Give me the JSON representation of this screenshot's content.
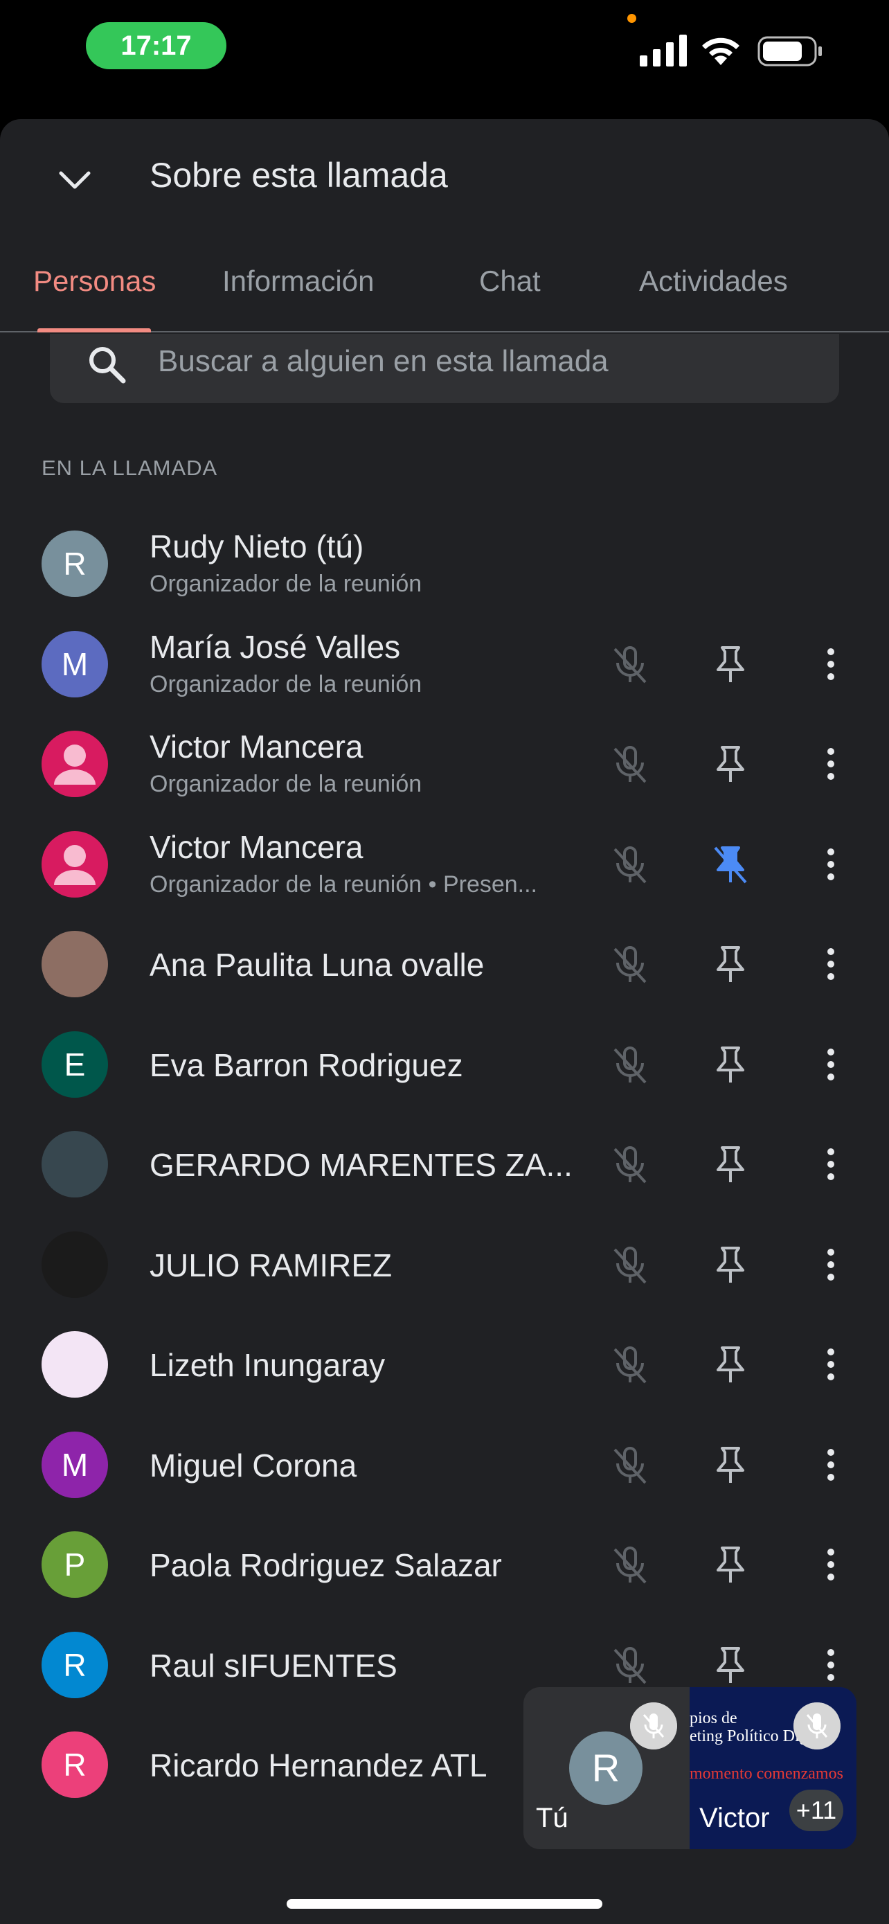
{
  "status_bar": {
    "time": "17:17"
  },
  "header": {
    "title": "Sobre esta llamada"
  },
  "tabs": [
    {
      "label": "Personas",
      "active": true
    },
    {
      "label": "Información",
      "active": false
    },
    {
      "label": "Chat",
      "active": false
    },
    {
      "label": "Actividades",
      "active": false
    }
  ],
  "search": {
    "placeholder": "Buscar a alguien en esta llamada"
  },
  "section_label": "EN LA LLAMADA",
  "participants": [
    {
      "name": "Rudy Nieto (tú)",
      "role": "Organizador de la reunión",
      "initial": "R",
      "color": "#78909c"
    },
    {
      "name": "María José Valles",
      "role": "Organizador de la reunión",
      "initial": "M",
      "color": "#5c6bc0"
    },
    {
      "name": "Victor Mancera",
      "role": "Organizador de la reunión",
      "initial": "",
      "color": "#d81b60"
    },
    {
      "name": "Victor Mancera",
      "role": "Organizador de la reunión • Presen...",
      "initial": "",
      "color": "#d81b60",
      "pinned": true
    },
    {
      "name": "Ana Paulita Luna ovalle",
      "role": "",
      "initial": "",
      "color": "#8d6e63"
    },
    {
      "name": "Eva Barron Rodriguez",
      "role": "",
      "initial": "E",
      "color": "#00574b"
    },
    {
      "name": "GERARDO MARENTES ZA...",
      "role": "",
      "initial": "",
      "color": "#37474f"
    },
    {
      "name": "JULIO RAMIREZ",
      "role": "",
      "initial": "",
      "color": "#1b1b1b"
    },
    {
      "name": "Lizeth Inungaray",
      "role": "",
      "initial": "",
      "color": "#f3e5f5"
    },
    {
      "name": "Miguel Corona",
      "role": "",
      "initial": "M",
      "color": "#8e24aa"
    },
    {
      "name": "Paola Rodriguez Salazar",
      "role": "",
      "initial": "P",
      "color": "#689f38"
    },
    {
      "name": "Raul sIFUENTES",
      "role": "",
      "initial": "R",
      "color": "#0288d1"
    },
    {
      "name": "Ricardo Hernandez ATL",
      "role": "",
      "initial": "R",
      "color": "#ec407a"
    }
  ],
  "tiles": {
    "self_label": "Tú",
    "self_initial": "R",
    "other_label": "Victor",
    "others_count": "+11",
    "slide_line1": "pios de",
    "slide_line2": "eting Político Digital",
    "slide_line3": "momento comenzamos"
  }
}
